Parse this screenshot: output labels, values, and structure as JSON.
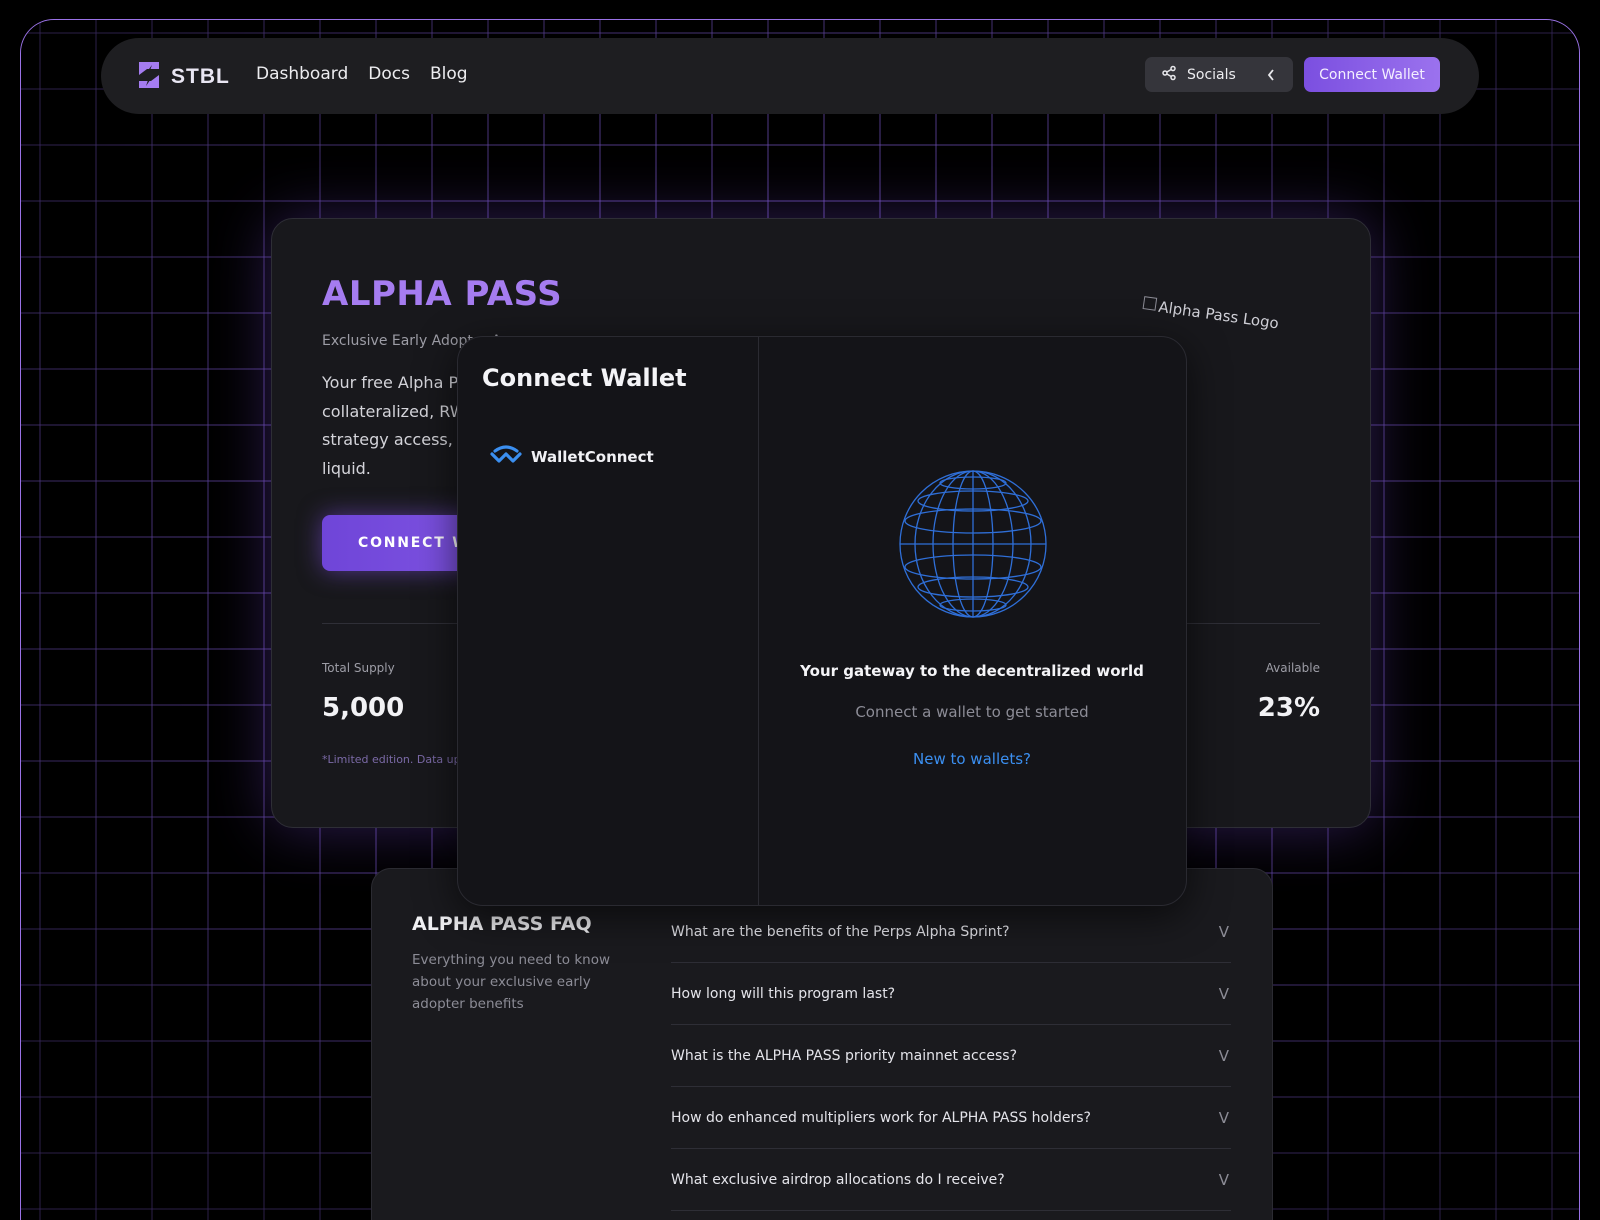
{
  "colors": {
    "accent": "#9b72ee",
    "title_purple": "#a57cf0",
    "link_blue": "#3b8ff0",
    "background": "#000000",
    "card": "#18181c"
  },
  "nav": {
    "logo_text": "STBL",
    "links": [
      "Dashboard",
      "Docs",
      "Blog"
    ],
    "socials_label": "Socials",
    "connect_label": "Connect Wallet"
  },
  "hero": {
    "title": "ALPHA PASS",
    "subtitle": "Exclusive Early Adopter A",
    "description_lines": [
      "Your free Alpha Pa",
      "collateralized, RWA",
      "strategy access, an",
      "liquid."
    ],
    "cta_label": "CONNECT W",
    "logo_alt": "Alpha Pass Logo",
    "stats": {
      "total_label": "Total Supply",
      "total_value": "5,000",
      "available_label": "Available",
      "available_value": "23%"
    },
    "footnote": "*Limited edition. Data up"
  },
  "faq": {
    "title": "ALPHA PASS FAQ",
    "subtitle": "Everything you need to know about your exclusive early adopter benefits",
    "items": [
      {
        "question": "What are the benefits of the Perps Alpha Sprint?",
        "chevron": "V"
      },
      {
        "question": "How long will this program last?",
        "chevron": "V"
      },
      {
        "question": "What is the ALPHA PASS priority mainnet access?",
        "chevron": "V"
      },
      {
        "question": "How do enhanced multipliers work for ALPHA PASS holders?",
        "chevron": "V"
      },
      {
        "question": "What exclusive airdrop allocations do I receive?",
        "chevron": "V"
      }
    ]
  },
  "modal": {
    "title": "Connect Wallet",
    "wallets": [
      {
        "label": "WalletConnect",
        "icon": "walletconnect-icon"
      }
    ],
    "heading": "Your gateway to the decentralized world",
    "subtext": "Connect a wallet to get started",
    "link": "New to wallets?"
  }
}
